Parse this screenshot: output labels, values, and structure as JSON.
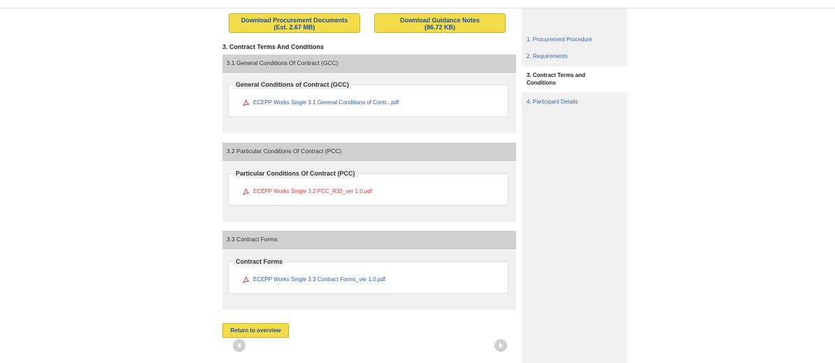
{
  "downloads": {
    "procurement_line1": "Download Procurement Documents",
    "procurement_line2": "(Est. 2.67 MB)",
    "guidance_line1": "Download Guidance Notes",
    "guidance_line2": "(86.72 KB)"
  },
  "section_title": "3. Contract Terms And Conditions",
  "sections": [
    {
      "header": "3.1 General Conditions Of Contract (GCC)",
      "legend": "General Conditions of Contract (GCC)",
      "file": "ECEPP Works Single 3.1 General Conditions of Contr...pdf"
    },
    {
      "header": "3.2 Particular Conditions Of Contract (PCC)",
      "legend": "Particular Conditions Of Contract (PCC)",
      "file": "ECEPP Works Single 3.2 PCC_R33_ver 1.0.pdf"
    },
    {
      "header": "3.3 Contract Forms",
      "legend": "Contract Forms",
      "file": "ECEPP Works Single 3.3 Contract Forms_ver 1.0.pdf"
    }
  ],
  "return_label": "Return to overview",
  "sidebar": {
    "items": [
      {
        "label": "1. Procurement Procedure"
      },
      {
        "label": "2. Requirements"
      },
      {
        "label_line1": "3. Contract Terms and",
        "label_line2": "Conditions"
      },
      {
        "label": "4. Participant Details"
      }
    ]
  },
  "colors": {
    "button_yellow": "#f3dc4a",
    "link_blue": "#2f5ba8",
    "highlight_red": "#d23b32"
  },
  "icons": [
    "pdf-file-icon",
    "arrow-left-icon",
    "arrow-right-icon"
  ]
}
